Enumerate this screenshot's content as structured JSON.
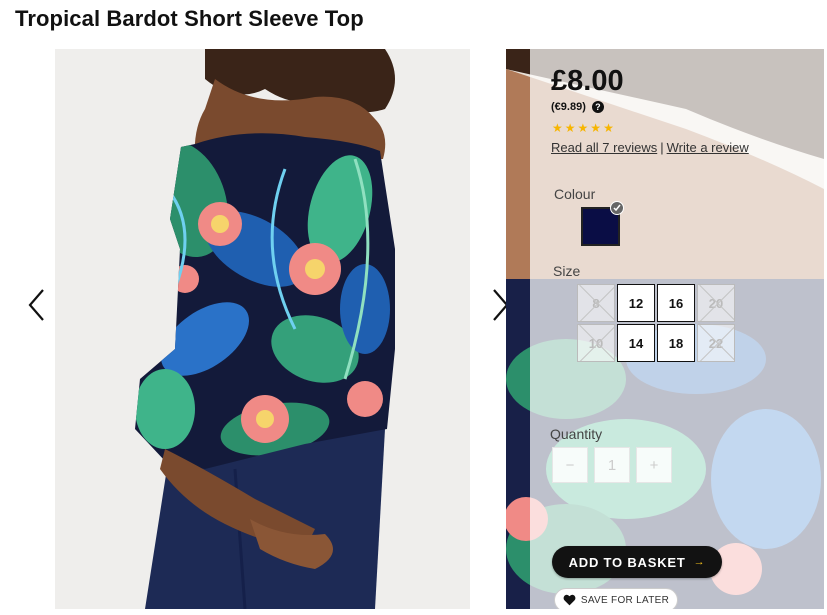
{
  "product": {
    "title": "Tropical Bardot Short Sleeve Top"
  },
  "gallery": {
    "prev_icon": "chevron-left-icon",
    "next_icon": "chevron-right-icon"
  },
  "pricing": {
    "price": "£8.00",
    "alt_price": "(€9.89)",
    "help_icon": "question-circle-icon"
  },
  "rating": {
    "stars": 5,
    "star_icon": "star-icon",
    "read_reviews": "Read all 7 reviews",
    "separator": "|",
    "write_review": "Write a review"
  },
  "colour": {
    "label": "Colour",
    "selected_swatch": "#0a0d45"
  },
  "size": {
    "label": "Size",
    "options": [
      {
        "value": "8",
        "available": false
      },
      {
        "value": "12",
        "available": true
      },
      {
        "value": "16",
        "available": true
      },
      {
        "value": "20",
        "available": false
      },
      {
        "value": "10",
        "available": false
      },
      {
        "value": "14",
        "available": true
      },
      {
        "value": "18",
        "available": true
      },
      {
        "value": "22",
        "available": false
      }
    ]
  },
  "quantity": {
    "label": "Quantity",
    "minus": "−",
    "value": "1",
    "plus": "+"
  },
  "actions": {
    "add_to_basket": "ADD TO BASKET",
    "basket_arrow": "→",
    "save_for_later": "SAVE FOR LATER",
    "heart_icon": "heart-icon"
  },
  "colors": {
    "price_text": "#111111",
    "star": "#f7b500",
    "basket_button": "#121212",
    "basket_arrow": "#f7c21b",
    "swatch_navy": "#0a0d45"
  }
}
